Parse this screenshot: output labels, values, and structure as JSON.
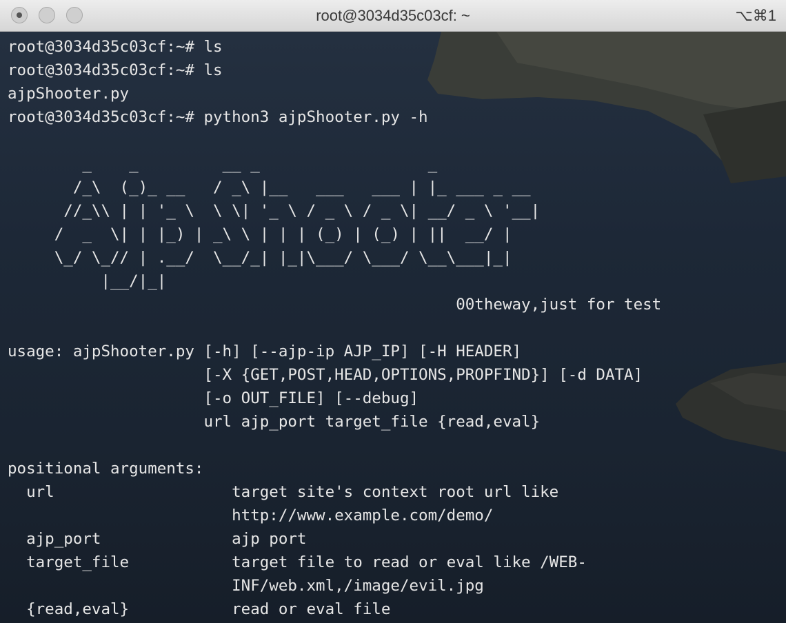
{
  "window": {
    "title": "root@3034d35c03cf: ~",
    "shortcut": "⌥⌘1"
  },
  "terminal": {
    "lines": [
      "root@3034d35c03cf:~# ls",
      "root@3034d35c03cf:~# ls",
      "ajpShooter.py",
      "root@3034d35c03cf:~# python3 ajpShooter.py -h",
      "",
      "        _    _         __ _                  _",
      "       /_\\  (_)_ __   / _\\ |__   ___   ___ | |_ ___ _ __",
      "      //_\\\\ | | '_ \\  \\ \\| '_ \\ / _ \\ / _ \\| __/ _ \\ '__|",
      "     /  _  \\| | |_) | _\\ \\ | | | (_) | (_) | ||  __/ |",
      "     \\_/ \\_// | .__/  \\__/_| |_|\\___/ \\___/ \\__\\___|_|",
      "          |__/|_|",
      "                                                00theway,just for test",
      "",
      "usage: ajpShooter.py [-h] [--ajp-ip AJP_IP] [-H HEADER]",
      "                     [-X {GET,POST,HEAD,OPTIONS,PROPFIND}] [-d DATA]",
      "                     [-o OUT_FILE] [--debug]",
      "                     url ajp_port target_file {read,eval}",
      "",
      "positional arguments:",
      "  url                   target site's context root url like",
      "                        http://www.example.com/demo/",
      "  ajp_port              ajp port",
      "  target_file           target file to read or eval like /WEB-",
      "                        INF/web.xml,/image/evil.jpg",
      "  {read,eval}           read or eval file"
    ]
  }
}
